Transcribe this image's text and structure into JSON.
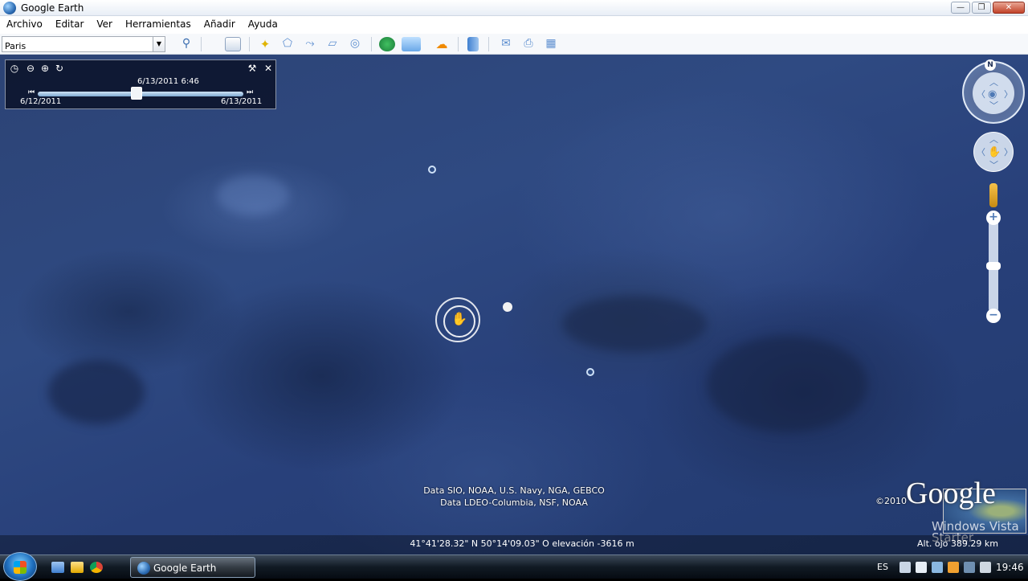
{
  "window": {
    "title": "Google Earth"
  },
  "menu": [
    "Archivo",
    "Editar",
    "Ver",
    "Herramientas",
    "Añadir",
    "Ayuda"
  ],
  "search": {
    "value": "Paris"
  },
  "toolbar": {
    "icons": [
      "search-icon",
      "sidebar-toggle-icon",
      "placemark-icon",
      "polygon-icon",
      "path-icon",
      "image-overlay-icon",
      "tour-icon",
      "historical-imagery-icon",
      "sunlight-icon",
      "sky-icon",
      "ruler-icon",
      "email-icon",
      "print-icon",
      "maps-icon"
    ]
  },
  "time_slider": {
    "current": "6/13/2011   6:46",
    "start": "6/12/2011",
    "end": "6/13/2011",
    "position_fraction": 0.48
  },
  "map": {
    "attribution_line1": "Data SIO, NOAA, U.S. Navy, NGA, GEBCO",
    "attribution_line2": "Data LDEO-Columbia, NSF, NOAA",
    "copyright": "©2010",
    "logo": "Google",
    "compass_north": "N"
  },
  "status": {
    "coordinates": "41°41'28.32\" N   50°14'09.03\" O  elevación -3616 m",
    "eye_alt": "Alt. ojo  389.29 km"
  },
  "watermark": {
    "line1": "Windows Vista",
    "line2": "Starter"
  },
  "taskbar": {
    "task_label": "Google Earth",
    "language": "ES",
    "clock": "19:46"
  },
  "colors": {
    "ocean": "#2c4375",
    "taskbar": "#111a24",
    "accent": "#4e79b5"
  }
}
